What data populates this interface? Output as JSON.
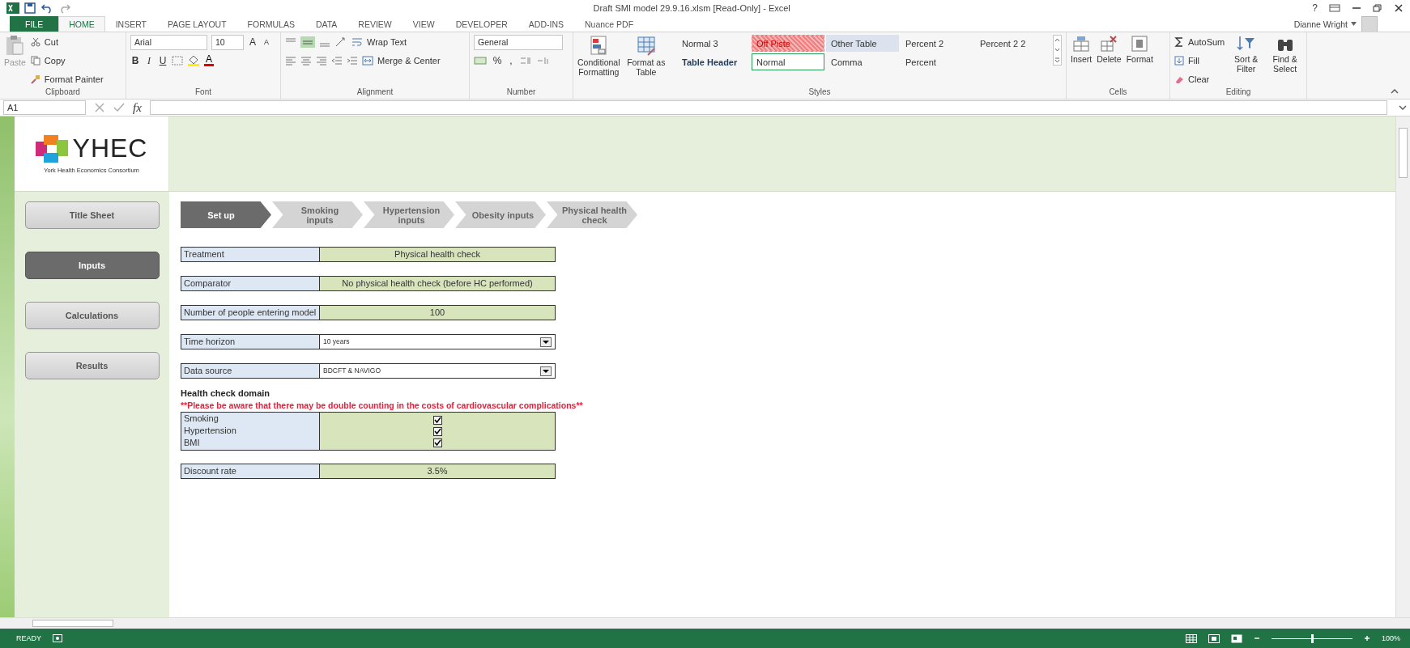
{
  "window": {
    "title": "Draft SMI model 29.9.16.xlsm  [Read-Only] - Excel",
    "help": "?",
    "user": "Dianne Wright"
  },
  "ribbon_tabs": [
    {
      "label": "FILE",
      "kind": "file",
      "selected": false
    },
    {
      "label": "HOME",
      "kind": "tab",
      "selected": true
    },
    {
      "label": "INSERT",
      "kind": "tab",
      "selected": false
    },
    {
      "label": "PAGE LAYOUT",
      "kind": "tab",
      "selected": false
    },
    {
      "label": "FORMULAS",
      "kind": "tab",
      "selected": false
    },
    {
      "label": "DATA",
      "kind": "tab",
      "selected": false
    },
    {
      "label": "REVIEW",
      "kind": "tab",
      "selected": false
    },
    {
      "label": "VIEW",
      "kind": "tab",
      "selected": false
    },
    {
      "label": "DEVELOPER",
      "kind": "tab",
      "selected": false
    },
    {
      "label": "ADD-INS",
      "kind": "tab",
      "selected": false
    },
    {
      "label": "Nuance PDF",
      "kind": "tab",
      "selected": false
    }
  ],
  "clipboard": {
    "label": "Clipboard",
    "paste": "Paste",
    "cut": "Cut",
    "copy": "Copy",
    "format_painter": "Format Painter"
  },
  "font": {
    "label": "Font",
    "family": "Arial",
    "size": "10",
    "grow": "A",
    "shrink": "A",
    "bold": "B",
    "italic": "I",
    "underline": "U",
    "color_button": "A"
  },
  "alignment": {
    "label": "Alignment",
    "wrap_text": "Wrap Text",
    "merge_center": "Merge & Center"
  },
  "number": {
    "label": "Number",
    "format": "General",
    "percent": "%",
    "comma": ","
  },
  "styles": {
    "label": "Styles",
    "conditional_formatting": "Conditional Formatting",
    "format_as_table": "Format as Table",
    "gallery": [
      {
        "label": "Normal 3",
        "kind": "plain",
        "selected": false
      },
      {
        "label": "Off Piste",
        "kind": "hatched",
        "selected": false
      },
      {
        "label": "Other Table",
        "kind": "shaded",
        "selected": false
      },
      {
        "label": "Percent 2",
        "kind": "plain",
        "selected": false
      },
      {
        "label": "Percent 2 2",
        "kind": "plain",
        "selected": false
      },
      {
        "label": "Table Header",
        "kind": "bold",
        "selected": false
      },
      {
        "label": "Normal",
        "kind": "plain",
        "selected": true
      },
      {
        "label": "Comma",
        "kind": "plain",
        "selected": false
      },
      {
        "label": "Percent",
        "kind": "plain",
        "selected": false
      }
    ]
  },
  "cells": {
    "label": "Cells",
    "insert": "Insert",
    "delete": "Delete",
    "format": "Format"
  },
  "editing": {
    "label": "Editing",
    "autosum": "AutoSum",
    "fill": "Fill",
    "clear": "Clear",
    "sort_filter": "Sort & Filter",
    "find_select": "Find & Select"
  },
  "formula_bar": {
    "name_box": "A1",
    "fx": "fx"
  },
  "logo": {
    "name": "YHEC",
    "tagline": "York Health Economics Consortium"
  },
  "nav": [
    {
      "label": "Title Sheet",
      "selected": false
    },
    {
      "label": "Inputs",
      "selected": true
    },
    {
      "label": "Calculations",
      "selected": false
    },
    {
      "label": "Results",
      "selected": false
    }
  ],
  "steps": [
    {
      "label": "Set up",
      "selected": true
    },
    {
      "label": "Smoking inputs",
      "selected": false
    },
    {
      "label": "Hypertension inputs",
      "selected": false
    },
    {
      "label": "Obesity inputs",
      "selected": false
    },
    {
      "label": "Physical health check",
      "selected": false
    }
  ],
  "inputs": [
    {
      "label": "Treatment",
      "value": "Physical health check",
      "kind": "value"
    },
    {
      "label": "Comparator",
      "value": "No physical health check (before HC performed)",
      "kind": "value"
    },
    {
      "label": "Number of people entering model",
      "value": "100",
      "kind": "value"
    },
    {
      "label": "Time horizon",
      "value": "10 years",
      "kind": "dropdown"
    },
    {
      "label": "Data source",
      "value": "BDCFT & NAVIGO",
      "kind": "dropdown"
    }
  ],
  "domain": {
    "heading": "Health check domain",
    "warning": "**Please be aware that there may be double counting in the costs of cardiovascular complications**",
    "items": [
      {
        "label": "Smoking",
        "checked": true
      },
      {
        "label": "Hypertension",
        "checked": true
      },
      {
        "label": "BMI",
        "checked": true
      }
    ]
  },
  "discount": {
    "label": "Discount rate",
    "value": "3.5%"
  },
  "status_bar": {
    "mode": "READY",
    "zoom": "100%",
    "level": 0.5
  }
}
